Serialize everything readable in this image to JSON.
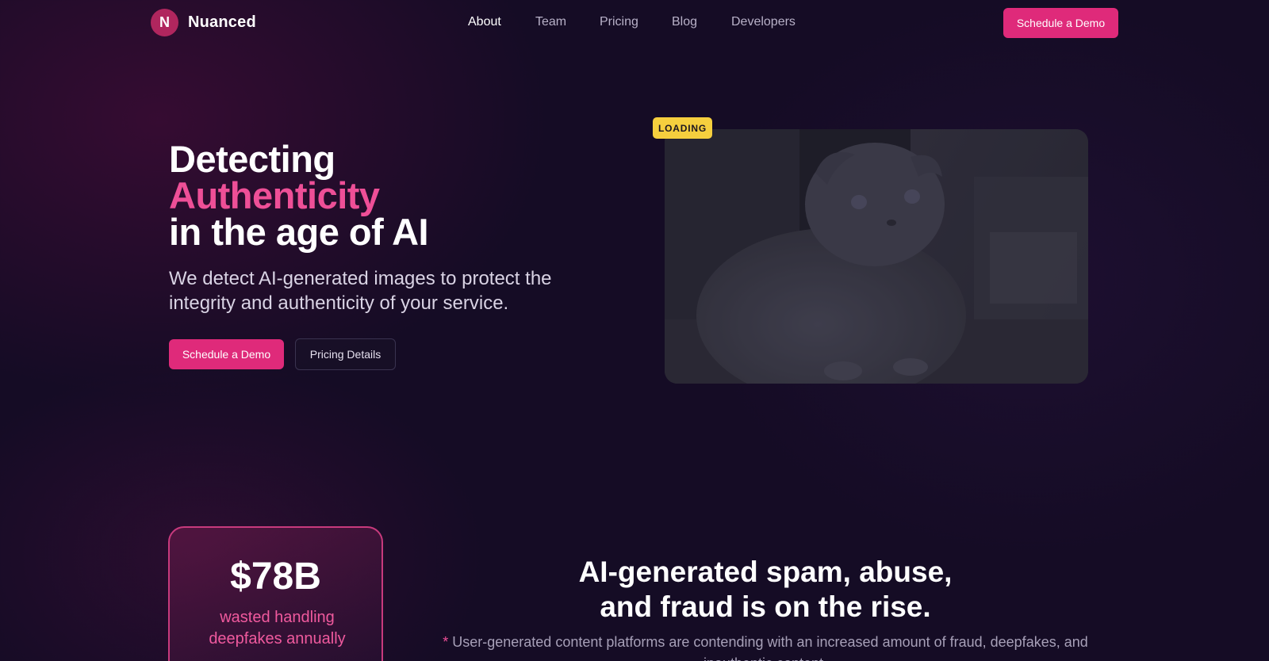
{
  "brand": {
    "logo_letter": "N",
    "name": "Nuanced"
  },
  "nav": {
    "links": [
      "About",
      "Team",
      "Pricing",
      "Blog",
      "Developers"
    ],
    "cta": "Schedule a Demo"
  },
  "hero": {
    "title_line1": "Detecting",
    "title_line2": "Authenticity",
    "title_line3": "in the age of AI",
    "subtitle": "We detect AI-generated images to protect the integrity and authenticity of your service.",
    "primary_button": "Schedule a Demo",
    "secondary_button": "Pricing Details"
  },
  "preview": {
    "badge": "LOADING"
  },
  "stat": {
    "value": "$78B",
    "label": "wasted handling deepfakes annually"
  },
  "rise": {
    "title_line1": "AI-generated spam, abuse,",
    "title_line2": "and fraud is on the rise.",
    "note_star": "*",
    "note": " User-generated content platforms are contending with an increased amount of fraud, deepfakes, and inauthentic content."
  },
  "colors": {
    "accent": "#df2a7a",
    "highlight": "#ee4f97",
    "badge": "#f5cf3e",
    "background": "#150c25"
  }
}
